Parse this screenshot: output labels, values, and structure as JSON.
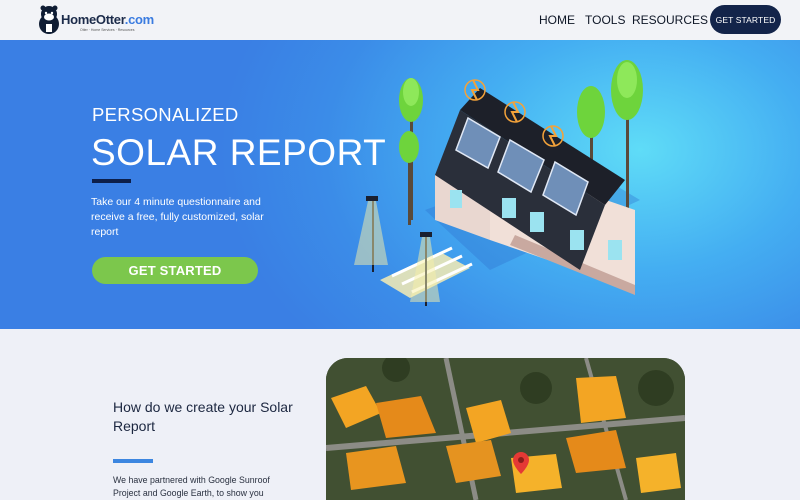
{
  "header": {
    "logo_name": "HomeOtter",
    "logo_suffix": ".com",
    "logo_tagline": "Otter · Home Services · Resources",
    "nav": {
      "home": "HOME",
      "tools": "TOOLS",
      "resources": "RESOURCES"
    },
    "cta": "GET STARTED"
  },
  "hero": {
    "kicker": "PERSONALIZED",
    "title": "SOLAR REPORT",
    "description": "Take our 4 minute questionnaire and receive a free, fully customized, solar report",
    "cta": "GET STARTED"
  },
  "how": {
    "title": "How do we create your Solar Report",
    "description": "We have partnered with Google Sunroof Project and Google Earth, to show you"
  },
  "colors": {
    "accent": "#3c86e0",
    "navy": "#13244a",
    "cta_green": "#7cc74c"
  },
  "icons": [
    "otter-logo-icon",
    "map-pin-icon"
  ]
}
